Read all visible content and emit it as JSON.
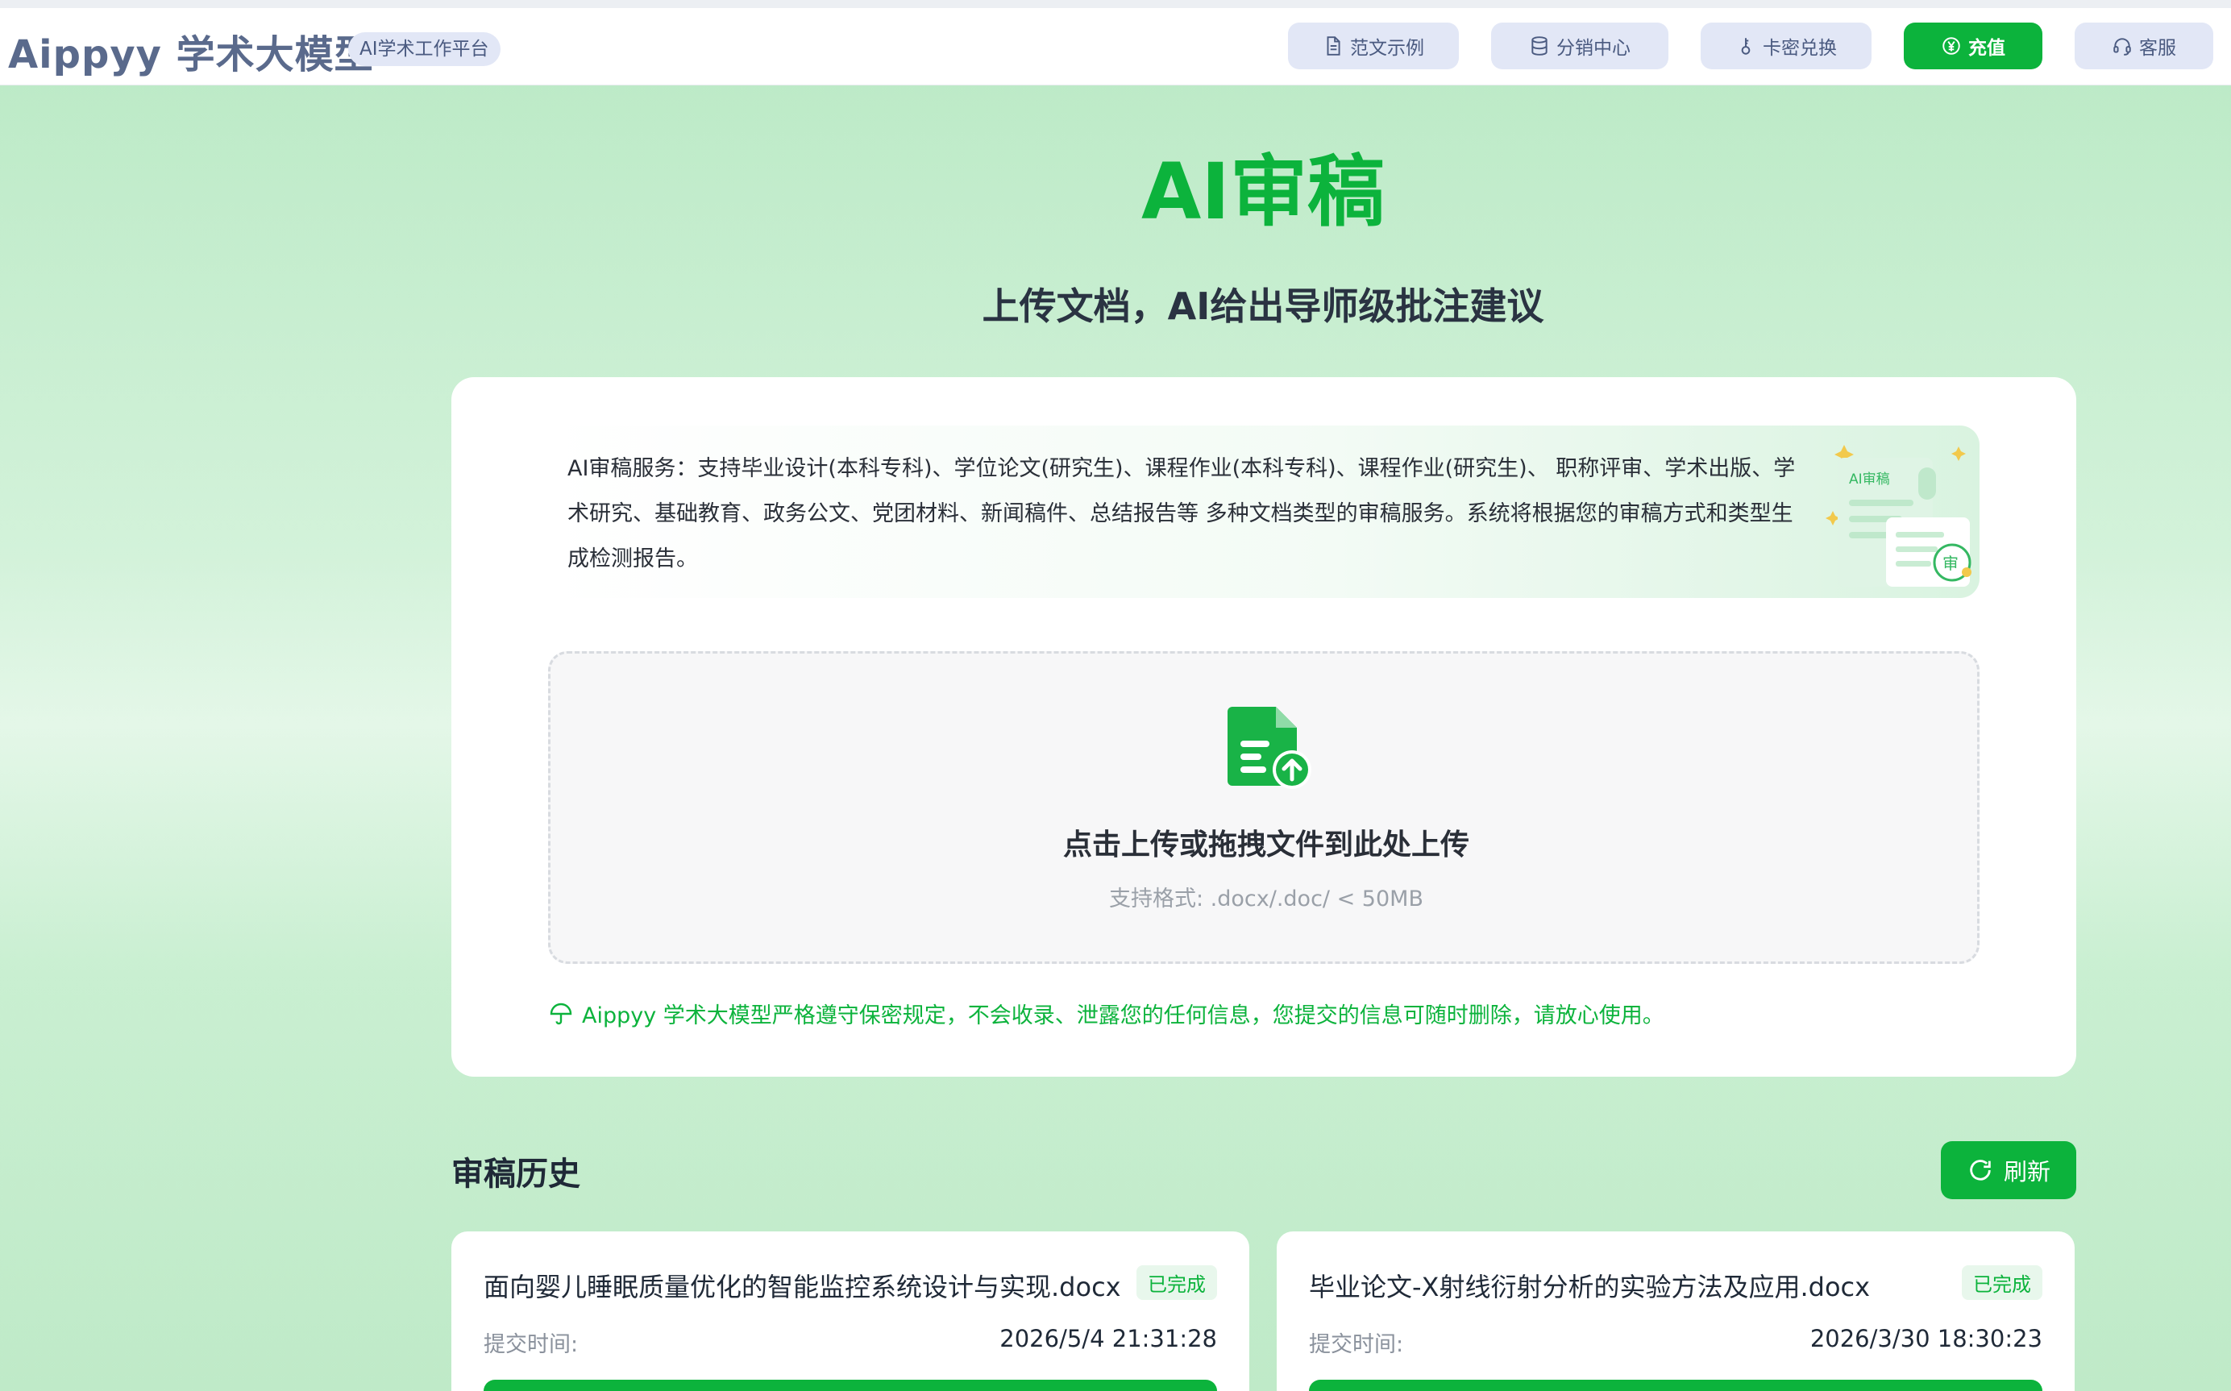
{
  "header": {
    "brand": "Aippyy 学术大模型",
    "badge": "AI学术工作平台",
    "nav": [
      {
        "label": "范文示例",
        "icon": "document-icon"
      },
      {
        "label": "分销中心",
        "icon": "database-icon"
      },
      {
        "label": "卡密兑换",
        "icon": "key-icon"
      },
      {
        "label": "充值",
        "icon": "yuan-coin-icon"
      },
      {
        "label": "客服",
        "icon": "headset-icon"
      }
    ]
  },
  "hero": {
    "title": "AI审稿",
    "subtitle": "上传文档，AI给出导师级批注建议"
  },
  "intro": {
    "text": "AI审稿服务：支持毕业设计(本科专科)、学位论文(研究生)、课程作业(本科专科)、课程作业(研究生)、 职称评审、学术出版、学术研究、基础教育、政务公文、党团材料、新闻稿件、总结报告等 多种文档类型的审稿服务。系统将根据您的审稿方式和类型生成检测报告。",
    "illustration_label": "AI审稿",
    "illustration_stamp": "审"
  },
  "upload": {
    "title": "点击上传或拖拽文件到此处上传",
    "hint": "支持格式: .docx/.doc/ < 50MB"
  },
  "privacy": {
    "text": "Aippyy 学术大模型严格遵守保密规定，不会收录、泄露您的任何信息，您提交的信息可随时删除，请放心使用。"
  },
  "history": {
    "title": "审稿历史",
    "refresh_label": "刷新",
    "items": [
      {
        "filename": "面向婴儿睡眠质量优化的智能监控系统设计与实现.docx",
        "status": "已完成",
        "time_label": "提交时间:",
        "time": "2026/5/4 21:31:28"
      },
      {
        "filename": "毕业论文-X射线衍射分析的实验方法及应用.docx",
        "status": "已完成",
        "time_label": "提交时间:",
        "time": "2026/3/30 18:30:23"
      }
    ]
  },
  "colors": {
    "accent": "#0cb33c",
    "brand_text": "#5a6a8c",
    "nav_bg": "#e2e7f6"
  }
}
